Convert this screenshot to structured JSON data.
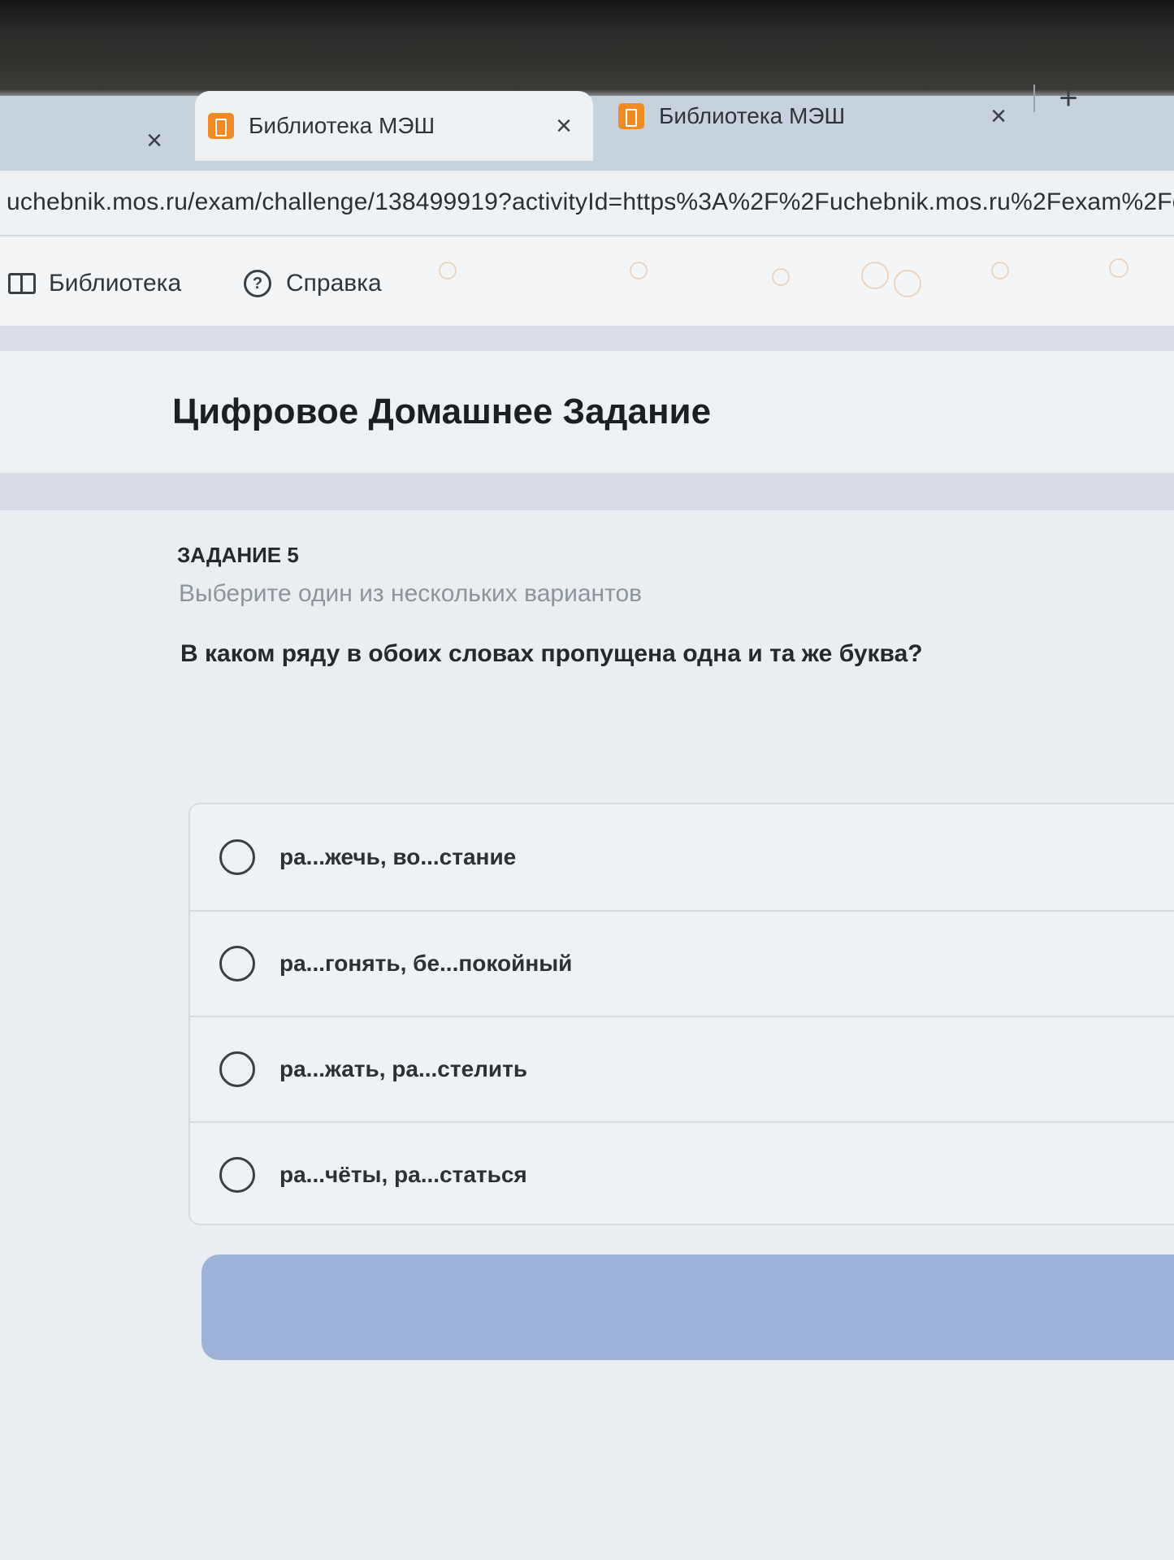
{
  "browser": {
    "tabs": [
      {
        "title": "",
        "close": "×"
      },
      {
        "title": "Библиотека МЭШ",
        "close": "×"
      },
      {
        "title": "Библиотека МЭШ",
        "close": "×"
      }
    ],
    "new_tab": "+",
    "url": "uchebnik.mos.ru/exam/challenge/138499919?activityId=https%3A%2F%2Fuchebnik.mos.ru%2Fexam%2Fcha"
  },
  "site_nav": {
    "library": "Библиотека",
    "help": "Справка",
    "help_icon_glyph": "?"
  },
  "page": {
    "title": "Цифровое Домашнее Задание"
  },
  "task": {
    "number": "ЗАДАНИЕ 5",
    "hint": "Выберите один из нескольких вариантов",
    "question": "В каком ряду в обоих словах пропущена одна и та же буква?",
    "options": [
      "ра...жечь, во...стание",
      "ра...гонять, бе...покойный",
      "ра...жать, ра...стелить",
      "ра...чёты, ра...статься"
    ],
    "selected_option": null
  },
  "colors": {
    "favicon": "#f08a24",
    "submit_button": "#9fb3d9",
    "hint_text": "#8d949a"
  }
}
